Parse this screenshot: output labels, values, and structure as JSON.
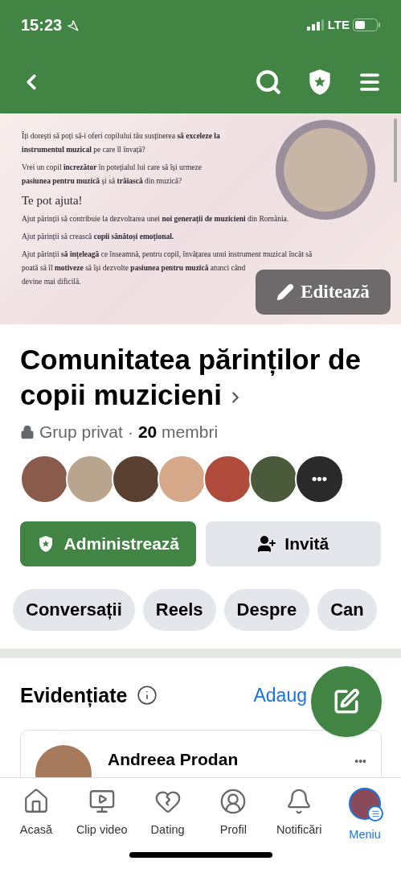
{
  "status_bar": {
    "time": "15:23",
    "network": "LTE"
  },
  "cover": {
    "paragraphs": [
      {
        "kind": "body",
        "lines": [
          "Îți dorești să poți să-i oferi copilului tău susținerea **să exceleze la**",
          "**instrumentul muzical** pe care îl învață?"
        ]
      },
      {
        "kind": "body",
        "lines": [
          "Vrei un copil **încrezător** în potețialul lui care să își urmeze",
          "**pasiunea pentru muzică** și să **trăiască** din muzică?"
        ]
      },
      {
        "kind": "heading",
        "lines": [
          "Te pot ajuta!"
        ]
      },
      {
        "kind": "body",
        "lines": [
          "Ajut părinții să contribuie la dezvoltarea unei **noi generații de muzicieni** din România."
        ]
      },
      {
        "kind": "body",
        "lines": [
          "Ajut părinții să crească **copii sănătoși emoțional.**"
        ]
      },
      {
        "kind": "body",
        "lines": [
          "Ajut părinții **să înțeleagă** ce înseamnă, pentru copil, învățarea unui instrument muzical încât să",
          "poată să îl **motiveze** să își dezvolte **pasiunea pentru muzică** atunci când",
          "devine mai dificilă."
        ]
      }
    ],
    "edit_button": "Editează"
  },
  "group": {
    "name": "Comunitatea părinților de copii muzicieni",
    "privacy": "Grup privat",
    "separator": "·",
    "members_count": "20",
    "members_label": "membri",
    "avatars": [
      {
        "kind": "photo",
        "color": "#8a5a4a"
      },
      {
        "kind": "photo",
        "color": "#b9a58e"
      },
      {
        "kind": "photo",
        "color": "#5a4030"
      },
      {
        "kind": "photo",
        "color": "#d6a88a"
      },
      {
        "kind": "photo",
        "color": "#b04a3a"
      },
      {
        "kind": "photo",
        "color": "#4a5a3a"
      },
      {
        "kind": "more",
        "color": "#2a2a2a",
        "label": "•••"
      }
    ]
  },
  "actions": [
    {
      "label": "Administrează",
      "kind": "primary"
    },
    {
      "label": "Invită",
      "kind": "secondary"
    }
  ],
  "chips": [
    "Conversații",
    "Reels",
    "Despre",
    "Can"
  ],
  "featured": {
    "title": "Evidențiate",
    "action": "Adaug",
    "author": "Andreea Prodan",
    "more": "•••"
  },
  "tabs": [
    {
      "label": "Acasă",
      "kind": "home",
      "selected": false
    },
    {
      "label": "Clip video",
      "kind": "video",
      "selected": false
    },
    {
      "label": "Dating",
      "kind": "dating",
      "selected": false
    },
    {
      "label": "Profil",
      "kind": "profile",
      "selected": false
    },
    {
      "label": "Notificări",
      "kind": "bell",
      "selected": false
    },
    {
      "label": "Meniu",
      "kind": "menu",
      "selected": true
    }
  ]
}
